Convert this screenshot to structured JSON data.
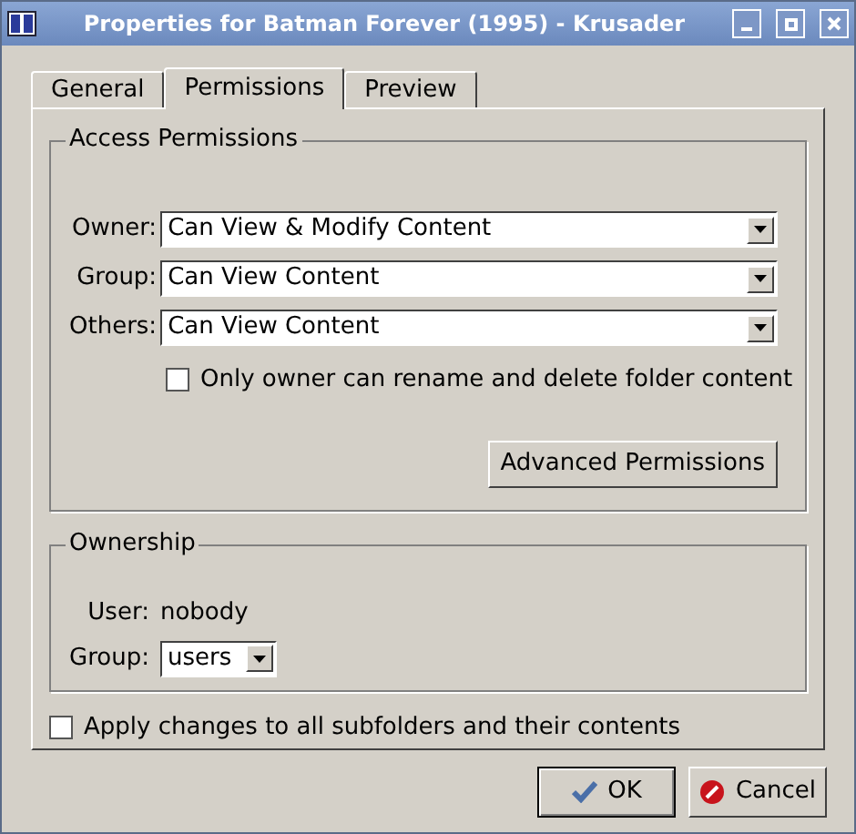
{
  "window": {
    "title": "Properties for Batman Forever (1995) - Krusader"
  },
  "tabs": [
    {
      "label": "General",
      "selected": false
    },
    {
      "label": "Permissions",
      "selected": true
    },
    {
      "label": "Preview",
      "selected": false
    }
  ],
  "access_permissions": {
    "title": "Access Permissions",
    "rows": [
      {
        "label": "Owner:",
        "value": "Can View & Modify Content"
      },
      {
        "label": "Group:",
        "value": "Can View Content"
      },
      {
        "label": "Others:",
        "value": "Can View Content"
      }
    ],
    "owner_only": {
      "label": "Only owner can rename and delete folder content",
      "checked": false
    },
    "advanced_button": "Advanced Permissions"
  },
  "ownership": {
    "title": "Ownership",
    "user_label": "User:",
    "user": "nobody",
    "group_label": "Group:",
    "group": "users"
  },
  "apply_recursive": {
    "label": "Apply changes to all subfolders and their contents",
    "checked": false
  },
  "buttons": [
    {
      "kind": "ok",
      "label": "OK"
    },
    {
      "kind": "cancel",
      "label": "Cancel"
    }
  ]
}
